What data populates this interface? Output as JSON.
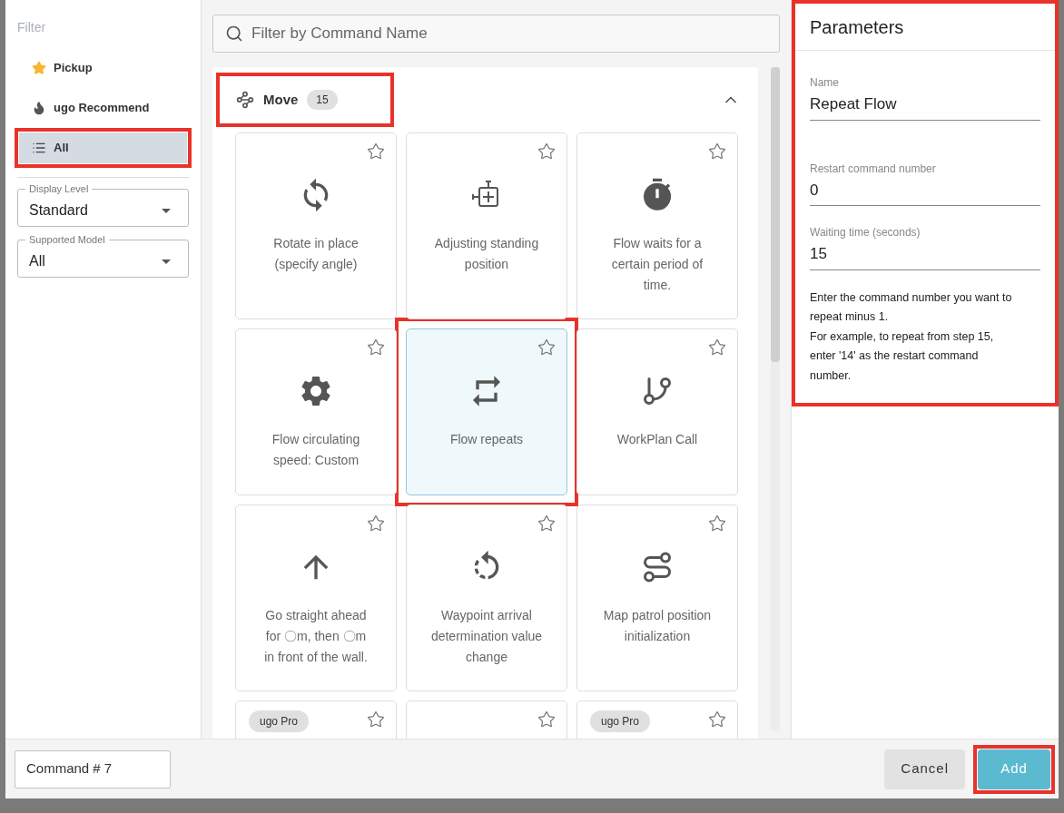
{
  "filter": {
    "title": "Filter",
    "items": [
      {
        "label": "Pickup",
        "selected": false,
        "highlighted": false
      },
      {
        "label": "ugo Recommend",
        "selected": false,
        "highlighted": false
      },
      {
        "label": "All",
        "selected": true,
        "highlighted": true
      }
    ],
    "selects": [
      {
        "label": "Display Level",
        "value": "Standard"
      },
      {
        "label": "Supported Model",
        "value": "All"
      }
    ]
  },
  "search": {
    "placeholder": "Filter by Command Name"
  },
  "group": {
    "title": "Move",
    "count": "15",
    "expanded": true,
    "highlighted": true
  },
  "cards": [
    {
      "label": "Rotate in place (specify angle)",
      "selected": false,
      "starred": false
    },
    {
      "label": "Adjusting standing position",
      "selected": false,
      "starred": false
    },
    {
      "label": "Flow waits for a certain period of time.",
      "selected": false,
      "starred": false
    },
    {
      "label": "Flow circulating speed: Custom",
      "selected": false,
      "starred": false
    },
    {
      "label": "Flow repeats",
      "selected": true,
      "starred": false
    },
    {
      "label": "WorkPlan Call",
      "selected": false,
      "starred": false
    },
    {
      "label": "Go straight ahead for 〇m, then 〇m in front of the wall.",
      "selected": false,
      "starred": false
    },
    {
      "label": "Waypoint arrival determination value change",
      "selected": false,
      "starred": false
    },
    {
      "label": "Map patrol position initialization",
      "selected": false,
      "starred": false
    },
    {
      "selected": false,
      "starred": false,
      "tags": [
        "ugo Pro"
      ]
    },
    {
      "selected": false,
      "starred": false
    },
    {
      "selected": false,
      "starred": false,
      "tags": [
        "ugo Pro"
      ]
    }
  ],
  "parameters": {
    "title": "Parameters",
    "highlighted": true,
    "fields": [
      {
        "label": "Name",
        "value": "Repeat Flow"
      },
      {
        "label": "Restart command number",
        "value": "0"
      },
      {
        "label": "Waiting time (seconds)",
        "value": "15"
      }
    ],
    "help": [
      "Enter the command number you want to repeat minus 1.",
      "For example, to repeat from step 15, enter '14' as the restart command number."
    ]
  },
  "footer": {
    "command": "Command # 7",
    "buttons": [
      {
        "kind": "secondary",
        "label": "Cancel",
        "highlighted": false
      },
      {
        "kind": "primary",
        "label": "Add",
        "highlighted": true
      }
    ]
  }
}
